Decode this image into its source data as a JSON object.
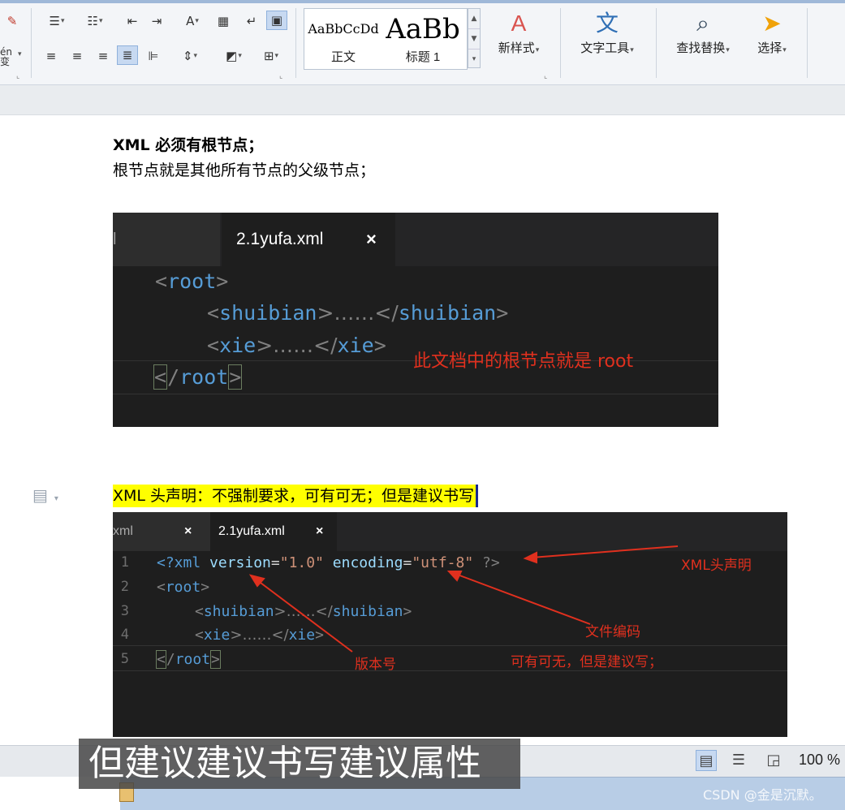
{
  "ribbon": {
    "left_partial_label": "én\n变",
    "paragraph_row1": [
      "bullets",
      "numbering",
      "decrease-indent",
      "increase-indent",
      "text-direction",
      "table",
      "line-break",
      "border-box"
    ],
    "paragraph_row2": [
      "align-left",
      "align-center",
      "align-right",
      "justify",
      "distribute",
      "line-spacing",
      "shading",
      "borders"
    ],
    "styles": [
      {
        "preview": "AaBbCcDd",
        "name": "正文"
      },
      {
        "preview": "AaBb",
        "name": "标题 1"
      }
    ],
    "new_style_label": "新样式",
    "text_tools_label": "文字工具",
    "find_replace_label": "查找替换",
    "select_label": "选择"
  },
  "document": {
    "line1_bold": "XML 必须有根节点；",
    "line2": "根节点就是其他所有节点的父级节点；",
    "shot1": {
      "tab_prev": "l",
      "tab_active": "2.1yufa.xml",
      "tab_close": "×",
      "code": [
        {
          "open": "<",
          "tag": "root",
          "close": ">"
        },
        {
          "open": "<",
          "tag": "shuibian",
          "mid": ">……</",
          "tag2": "shuibian",
          "close": ">"
        },
        {
          "open": "<",
          "tag": "xie",
          "mid": ">……</",
          "tag2": "xie",
          "close": ">"
        },
        {
          "open": "<",
          "slash": "/",
          "tag": "root",
          "close": ">"
        }
      ],
      "note": "此文档中的根节点就是 root"
    },
    "highlight_line": "XML 头声明：不强制要求，可有可无；但是建议书写",
    "shot2": {
      "tab_prev": "xml",
      "tab_active": "2.1yufa.xml",
      "tab_close": "×",
      "line_numbers": [
        "1",
        "2",
        "3",
        "4",
        "5"
      ],
      "decl": {
        "open": "<?xml",
        "attr1": "version",
        "eq": "=",
        "val1": "\"1.0\"",
        "attr2": "encoding",
        "val2": "\"utf-8\"",
        "close": "?>"
      },
      "root_open": "root",
      "shuibian": "shuibian",
      "xie": "xie",
      "ellipsis": ">……</",
      "annotations": {
        "xml_header": "XML头声明",
        "encoding": "文件编码",
        "version": "版本号",
        "optional": "可有可无，但是建议写；"
      }
    }
  },
  "status": {
    "zoom": "100 %"
  },
  "subtitle": "但建议建议书写建议属性",
  "watermark": "CSDN @金是沉默。",
  "colors": {
    "editor_bg": "#1e1e1e",
    "tag_blue": "#569cd6",
    "annotation_red": "#e0301e",
    "highlight_yellow": "#ffff00"
  }
}
